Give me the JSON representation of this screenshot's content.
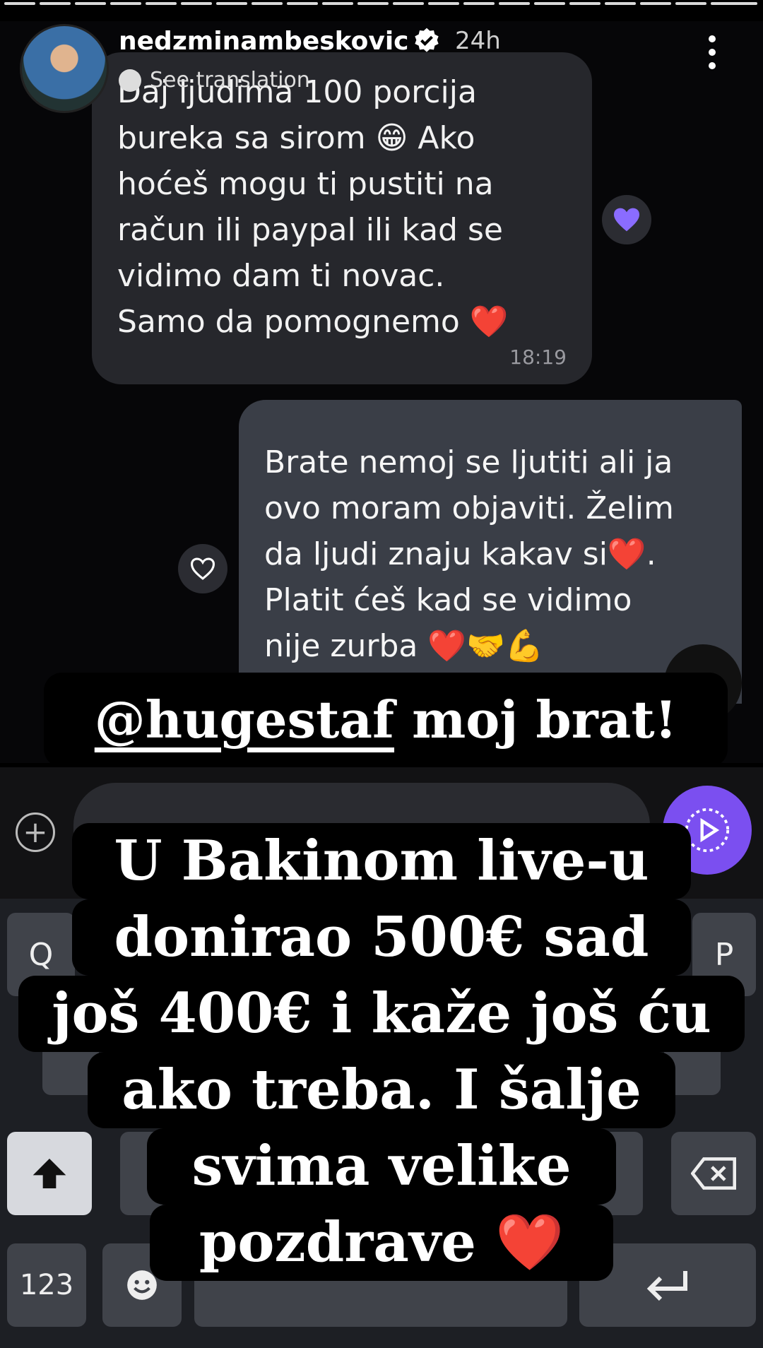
{
  "story": {
    "username": "nedzminambeskovic",
    "time_ago": "24h",
    "see_translation": "See translation"
  },
  "chat": {
    "incoming": {
      "lines": [
        "Daj ljudima 100 porcija",
        "bureka sa sirom 😁 Ako",
        "hoćeš mogu ti pustiti na",
        "račun ili paypal ili kad se",
        "vidimo dam ti novac.",
        "Samo da pomognemo ❤️"
      ],
      "time": "18:19",
      "reaction": "💜"
    },
    "outgoing": {
      "lines": [
        "Brate nemoj se ljutiti ali ja",
        "ovo moram objaviti. Želim",
        "da ljudi znaju kakav si❤️.",
        "Platit ćeš kad se vidimo",
        "nije zurba ❤️🤝💪"
      ]
    }
  },
  "captions": {
    "mention": "@hugestaf",
    "mention_rest": " moj brat!",
    "lines": [
      "U Bakinom live-u",
      "donirao 500€ sad",
      "još 400€ i kaže još ću",
      "ako treba. I šalje",
      "svima velike",
      "pozdrave ❤️"
    ]
  },
  "keyboard": {
    "q": "Q",
    "p": "P",
    "num": "123"
  },
  "icons": {
    "verified": "verified-badge-icon",
    "menu": "more-options-icon",
    "like": "heart-outline-icon",
    "send": "play-send-icon",
    "shift": "shift-arrow-icon",
    "backspace": "backspace-icon",
    "enter": "enter-icon",
    "plus": "plus-icon"
  },
  "colors": {
    "accent": "#7b4ff0",
    "bubble_in": "#26272c",
    "bubble_out": "#3a3e47"
  }
}
